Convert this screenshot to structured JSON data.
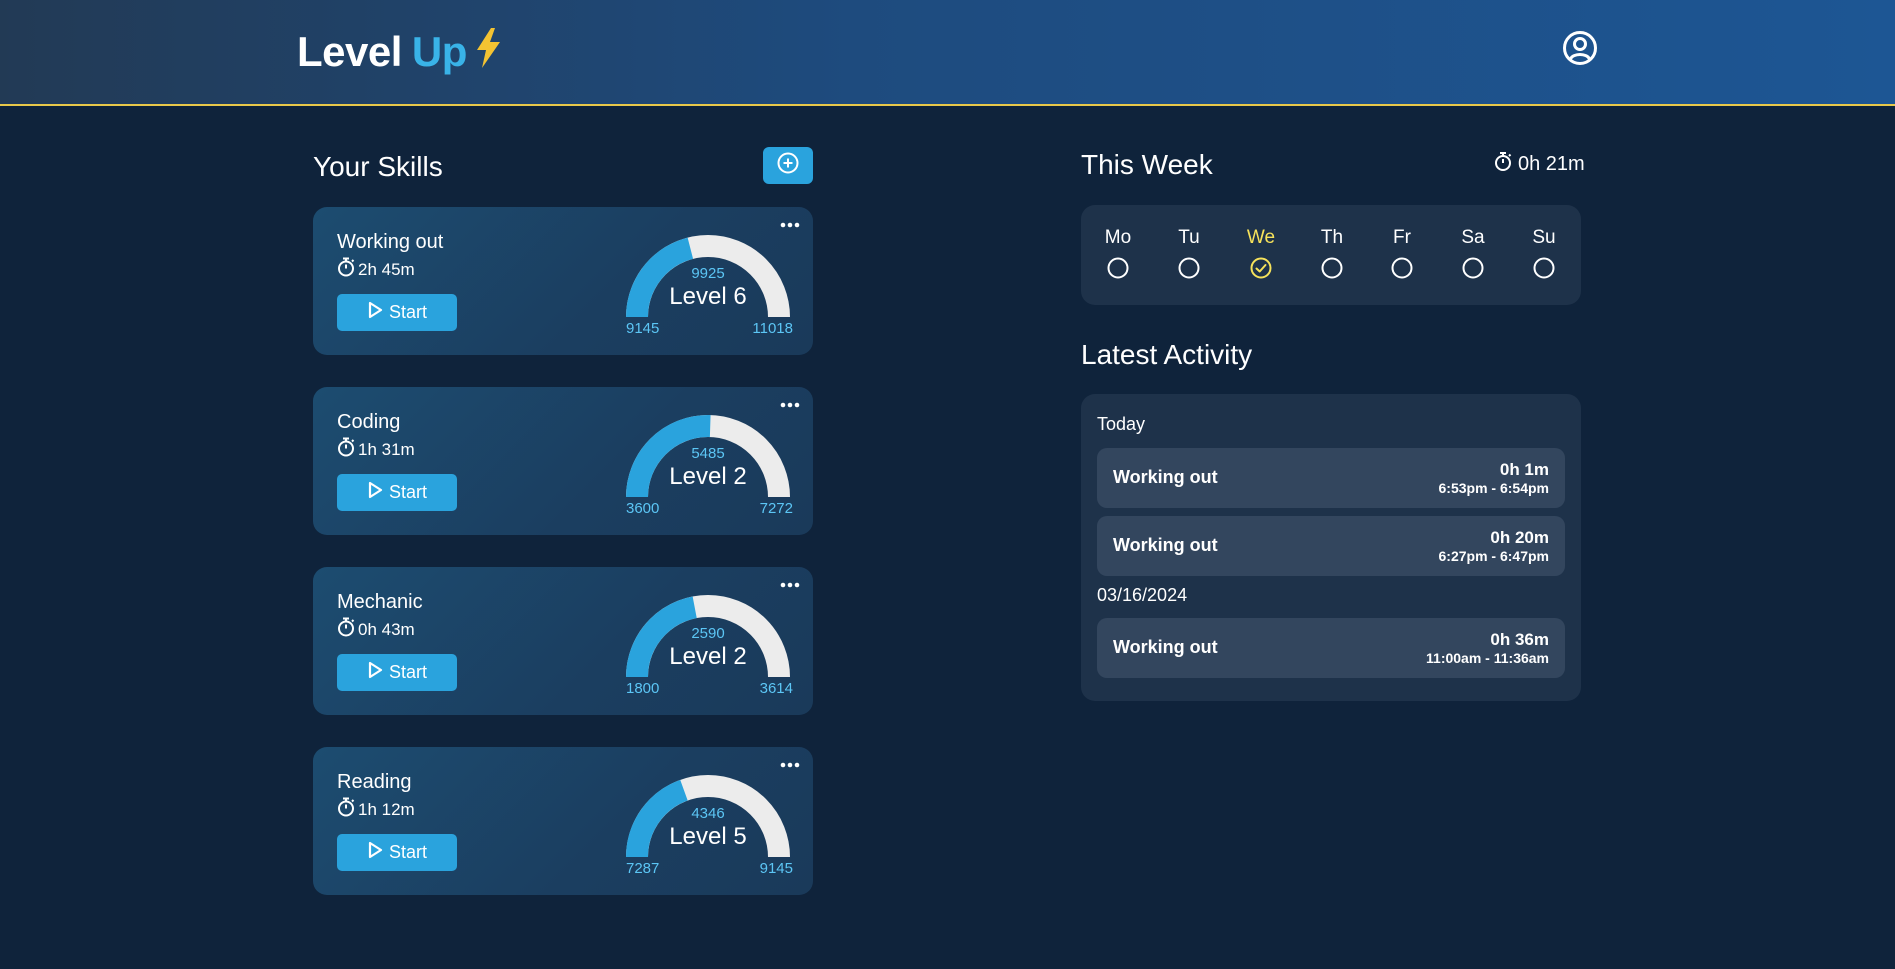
{
  "app": {
    "title_word1": "Level",
    "title_word2": "Up",
    "logo_icon": "lightning-bolt-icon",
    "profile_icon": "user-circle-icon"
  },
  "colors": {
    "accent": "#2aa3dd",
    "gauge_fill": "#2aa3dd",
    "gauge_track": "#ececec",
    "highlight_day": "#f6e25b",
    "header_border": "#e8c84a"
  },
  "skills_section": {
    "title": "Your Skills",
    "add_icon": "plus-circle-icon",
    "start_label": "Start",
    "skills": [
      {
        "name": "Working out",
        "time": "2h 45m",
        "current": "9925",
        "level": "Level 6",
        "min": "9145",
        "max": "11018",
        "progress": 0.42
      },
      {
        "name": "Coding",
        "time": "1h 31m",
        "current": "5485",
        "level": "Level 2",
        "min": "3600",
        "max": "7272",
        "progress": 0.51
      },
      {
        "name": "Mechanic",
        "time": "0h 43m",
        "current": "2590",
        "level": "Level 2",
        "min": "1800",
        "max": "3614",
        "progress": 0.44
      },
      {
        "name": "Reading",
        "time": "1h 12m",
        "current": "4346",
        "level": "Level 5",
        "min": "7287",
        "max": "9145",
        "progress": 0.39
      }
    ]
  },
  "week": {
    "title": "This Week",
    "total_time": "0h 21m",
    "days": [
      {
        "label": "Mo",
        "done": false
      },
      {
        "label": "Tu",
        "done": false
      },
      {
        "label": "We",
        "done": true
      },
      {
        "label": "Th",
        "done": false
      },
      {
        "label": "Fr",
        "done": false
      },
      {
        "label": "Sa",
        "done": false
      },
      {
        "label": "Su",
        "done": false
      }
    ]
  },
  "activity": {
    "title": "Latest Activity",
    "groups": [
      {
        "label": "Today",
        "items": [
          {
            "name": "Working out",
            "duration": "0h 1m",
            "range": "6:53pm - 6:54pm"
          },
          {
            "name": "Working out",
            "duration": "0h 20m",
            "range": "6:27pm - 6:47pm"
          }
        ]
      },
      {
        "label": "03/16/2024",
        "items": [
          {
            "name": "Working out",
            "duration": "0h 36m",
            "range": "11:00am - 11:36am"
          }
        ]
      }
    ]
  }
}
